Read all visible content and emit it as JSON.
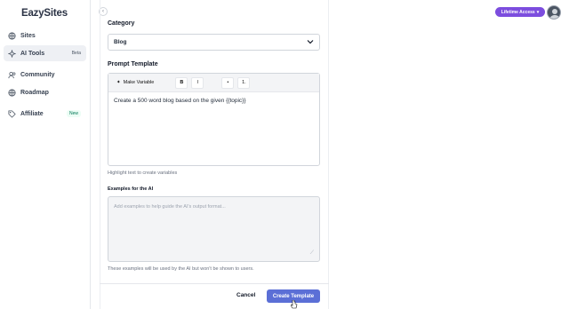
{
  "app": {
    "logo_text": "EazySites"
  },
  "sidebar": {
    "items": [
      {
        "label": "Sites",
        "icon": "globe-icon",
        "badge": ""
      },
      {
        "label": "AI Tools",
        "icon": "sparkle-icon",
        "badge": "Beta",
        "active": true
      },
      {
        "label": "Community",
        "icon": "users-icon",
        "badge": ""
      },
      {
        "label": "Roadmap",
        "icon": "globe-icon",
        "badge": ""
      },
      {
        "label": "Affiliate",
        "icon": "tag-icon",
        "badge": "New"
      }
    ]
  },
  "header": {
    "lifetime_label": "Lifetime Access",
    "lifetime_color": "#7c4dde"
  },
  "form": {
    "category_label": "Category",
    "category_value": "Blog",
    "prompt_label": "Prompt Template",
    "toolbar": {
      "make_variable": "Make Variable",
      "bold": "B",
      "italic": "I",
      "bullet": "•",
      "numbered": "1."
    },
    "prompt_text": "Create a 500 word blog based on the given {{topic}}",
    "prompt_hint": "Highlight text to create variables",
    "examples_label": "Examples for the AI",
    "examples_placeholder": "Add examples to help guide the AI's output format...",
    "examples_hint": "These examples will be used by the AI but won't be shown to users.",
    "cancel_label": "Cancel",
    "create_label": "Create Template",
    "accent_color": "#5b6fd6"
  }
}
